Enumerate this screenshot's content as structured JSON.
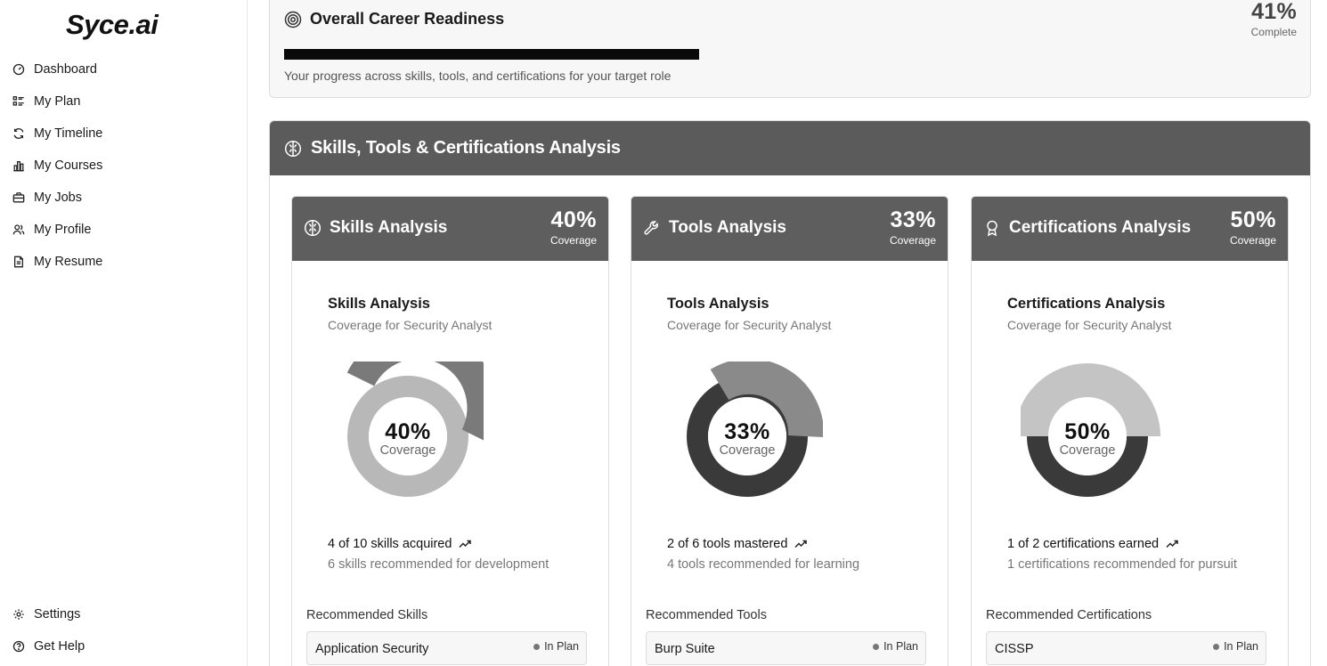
{
  "brand": {
    "logo": "Syce.ai"
  },
  "sidebar": {
    "items": [
      {
        "label": "Dashboard",
        "icon": "dashboard-gauge-icon"
      },
      {
        "label": "My Plan",
        "icon": "plan-list-icon"
      },
      {
        "label": "My Timeline",
        "icon": "timeline-refresh-icon"
      },
      {
        "label": "My Courses",
        "icon": "courses-chart-icon"
      },
      {
        "label": "My Jobs",
        "icon": "briefcase-icon"
      },
      {
        "label": "My Profile",
        "icon": "users-icon"
      },
      {
        "label": "My Resume",
        "icon": "document-icon"
      }
    ],
    "bottom": [
      {
        "label": "Settings",
        "icon": "gear-icon"
      },
      {
        "label": "Get Help",
        "icon": "help-circle-icon"
      }
    ]
  },
  "readiness": {
    "title": "Overall Career Readiness",
    "percent": "41%",
    "percent_label": "Complete",
    "progress_fraction": 0.41,
    "subtitle": "Your progress across skills, tools, and certifications for your target role"
  },
  "analysis": {
    "title": "Skills, Tools & Certifications Analysis",
    "cards": [
      {
        "header": "Skills Analysis",
        "header_pct": "40%",
        "header_pct_label": "Coverage",
        "title": "Skills Analysis",
        "subtitle": "Coverage for Security Analyst",
        "coverage": 40,
        "donut_pct": "40%",
        "donut_label": "Coverage",
        "stat": "4 of 10 skills acquired",
        "stat_sub": "6 skills recommended for development",
        "rec_title": "Recommended Skills",
        "rec_item": "Application Security",
        "rec_badge": "In Plan"
      },
      {
        "header": "Tools Analysis",
        "header_pct": "33%",
        "header_pct_label": "Coverage",
        "title": "Tools Analysis",
        "subtitle": "Coverage for Security Analyst",
        "coverage": 33,
        "donut_pct": "33%",
        "donut_label": "Coverage",
        "stat": "2 of 6 tools mastered",
        "stat_sub": "4 tools recommended for learning",
        "rec_title": "Recommended Tools",
        "rec_item": "Burp Suite",
        "rec_badge": "In Plan"
      },
      {
        "header": "Certifications Analysis",
        "header_pct": "50%",
        "header_pct_label": "Coverage",
        "title": "Certifications Analysis",
        "subtitle": "Coverage for Security Analyst",
        "coverage": 50,
        "donut_pct": "50%",
        "donut_label": "Coverage",
        "stat": "1 of 2 certifications earned",
        "stat_sub": "1 certifications recommended for pursuit",
        "rec_title": "Recommended Certifications",
        "rec_item": "CISSP",
        "rec_badge": "In Plan"
      }
    ]
  },
  "colors": {
    "header_dark": "#5b5b5b",
    "donut_dark": "#3c3c3c",
    "donut_mid": "#808080",
    "donut_light": "#b8b8b8"
  }
}
